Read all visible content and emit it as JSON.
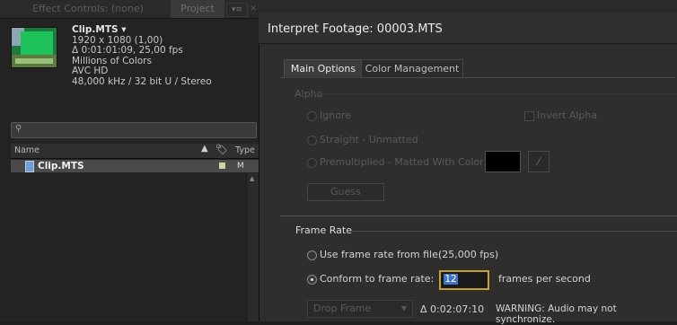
{
  "left_panel": {
    "tabs": {
      "effect_controls": "Effect Controls: (none)",
      "project": "Project",
      "menu": "▾≡",
      "close": "×"
    },
    "clip_info": {
      "name": "Clip.MTS ▾",
      "resolution": "1920 x 1080 (1,00)",
      "duration": "Δ 0:01:01:09, 25,00 fps",
      "colors": "Millions of Colors",
      "codec": "AVC HD",
      "audio": "48,000 kHz / 32 bit U / Stereo"
    },
    "search": {
      "placeholder": "",
      "icon": "search-icon"
    },
    "columns": {
      "name": "Name",
      "type": "Type"
    },
    "items": [
      {
        "name": "Clip.MTS",
        "type": "M",
        "label_color": "#c9d6a6"
      }
    ]
  },
  "dialog": {
    "title": "Interpret Footage: 00003.MTS",
    "tabs": [
      "Main Options",
      "Color Management"
    ],
    "alpha": {
      "section": "Alpha",
      "ignore": "Ignore",
      "invert_alpha": "Invert Alpha",
      "straight": "Straight - Unmatted",
      "premultiplied": "Premultiplied - Matted With Color:",
      "matte_color": "#000000",
      "guess": "Guess"
    },
    "frame_rate": {
      "section": "Frame Rate",
      "use_from_file": "Use frame rate from file:",
      "file_fps": "(25,000 fps)",
      "conform_to": "Conform to frame rate:",
      "conform_value": "12",
      "fps_unit": "frames per second",
      "drop_frame": "Drop Frame",
      "duration": "Δ 0:02:07:10",
      "warning": "WARNING: Audio may not synchronize."
    }
  },
  "colors": {
    "accent_input_border": "#c5a032",
    "selection": "#3f73c6"
  }
}
